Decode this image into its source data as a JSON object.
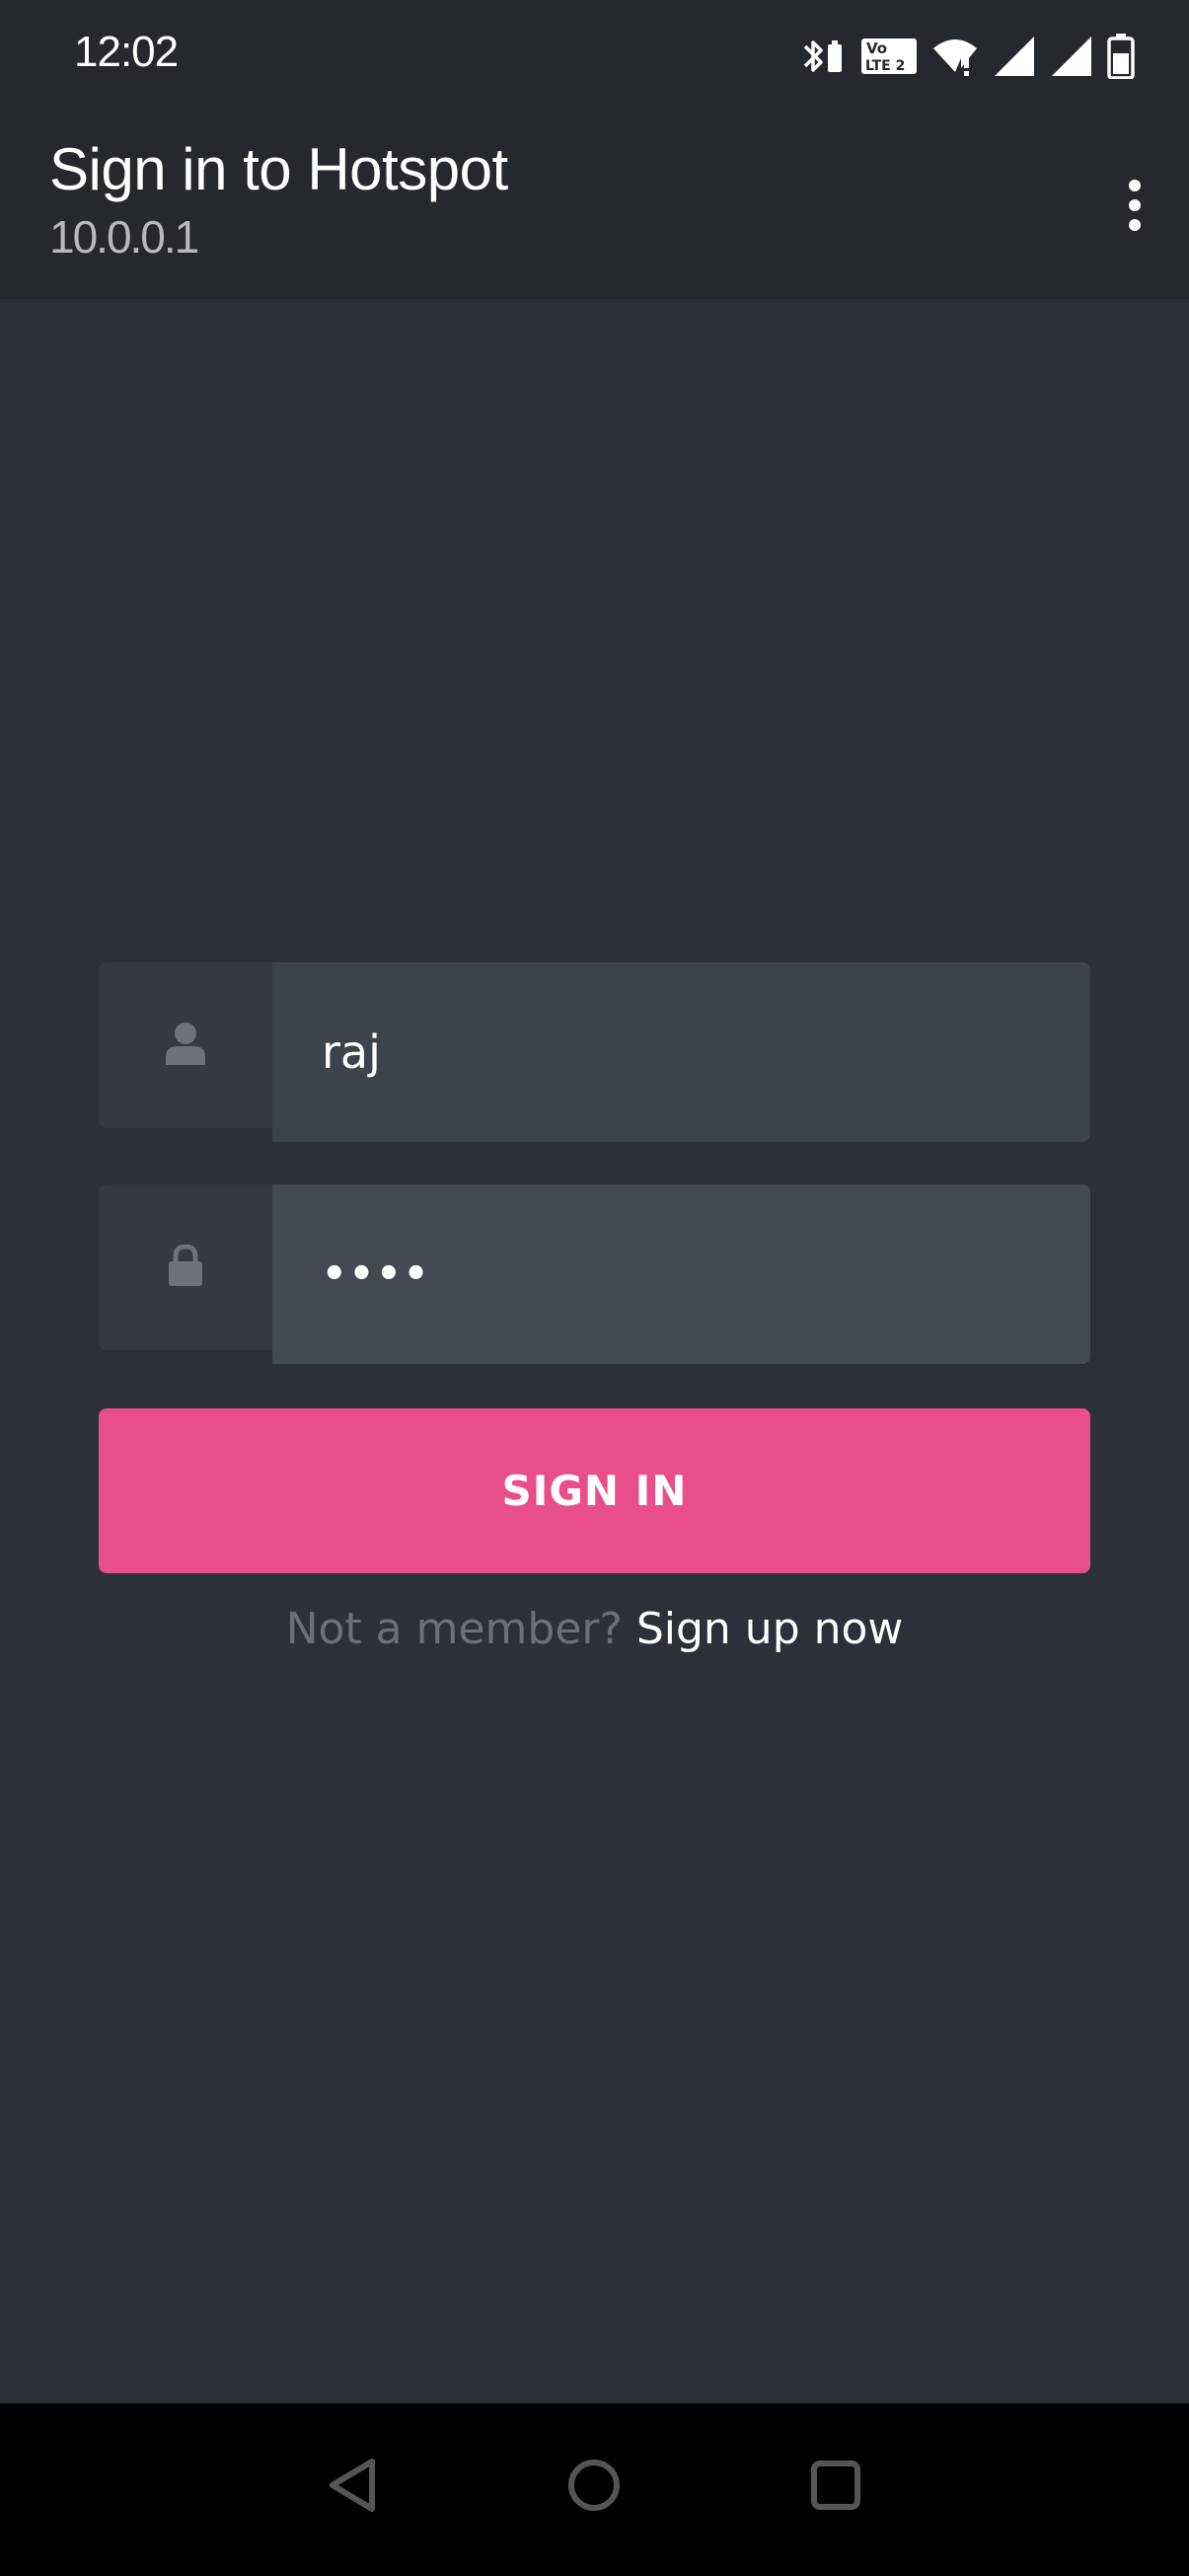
{
  "status_bar": {
    "time": "12:02",
    "icons": [
      "bluetooth-battery-icon",
      "volte-icon",
      "wifi-icon",
      "signal-icon",
      "signal-icon",
      "battery-icon"
    ],
    "volte_text_top": "Vo",
    "volte_text_bottom": "LTE 2"
  },
  "app_bar": {
    "title": "Sign in to Hotspot",
    "subtitle": "10.0.0.1",
    "menu_icon": "more-vert-icon"
  },
  "form": {
    "username": {
      "icon": "user-icon",
      "value": "raj"
    },
    "password": {
      "icon": "lock-icon",
      "value": "••••"
    },
    "signin_label": "SIGN IN",
    "signup_prompt": "Not a member?",
    "signup_link": "Sign up now"
  },
  "nav_bar": {
    "back_icon": "back-triangle-icon",
    "home_icon": "home-circle-icon",
    "recents_icon": "recents-square-icon"
  },
  "colors": {
    "background": "#2c3139",
    "bar": "#25282d",
    "accent": "#e84e89",
    "input_bg": "#3d434b",
    "addon_bg": "#353a42",
    "muted_text": "#6b7079"
  }
}
